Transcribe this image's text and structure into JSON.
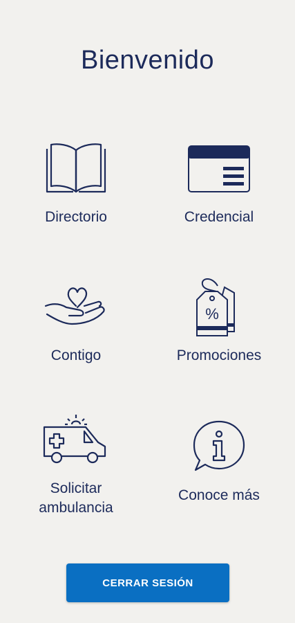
{
  "header": {
    "title": "Bienvenido"
  },
  "menu": {
    "items": [
      {
        "label": "Directorio",
        "icon": "open-book-icon"
      },
      {
        "label": "Credencial",
        "icon": "id-card-icon"
      },
      {
        "label": "Contigo",
        "icon": "hand-heart-icon"
      },
      {
        "label": "Promociones",
        "icon": "discount-tag-icon"
      },
      {
        "label": "Solicitar\nambulancia",
        "icon": "ambulance-icon"
      },
      {
        "label": "Conoce más",
        "icon": "info-bubble-icon"
      }
    ]
  },
  "footer": {
    "logout_label": "CERRAR SESIÓN"
  },
  "colors": {
    "background": "#f2f1ee",
    "primary_text": "#1c2a5a",
    "button": "#0a6fc2"
  }
}
